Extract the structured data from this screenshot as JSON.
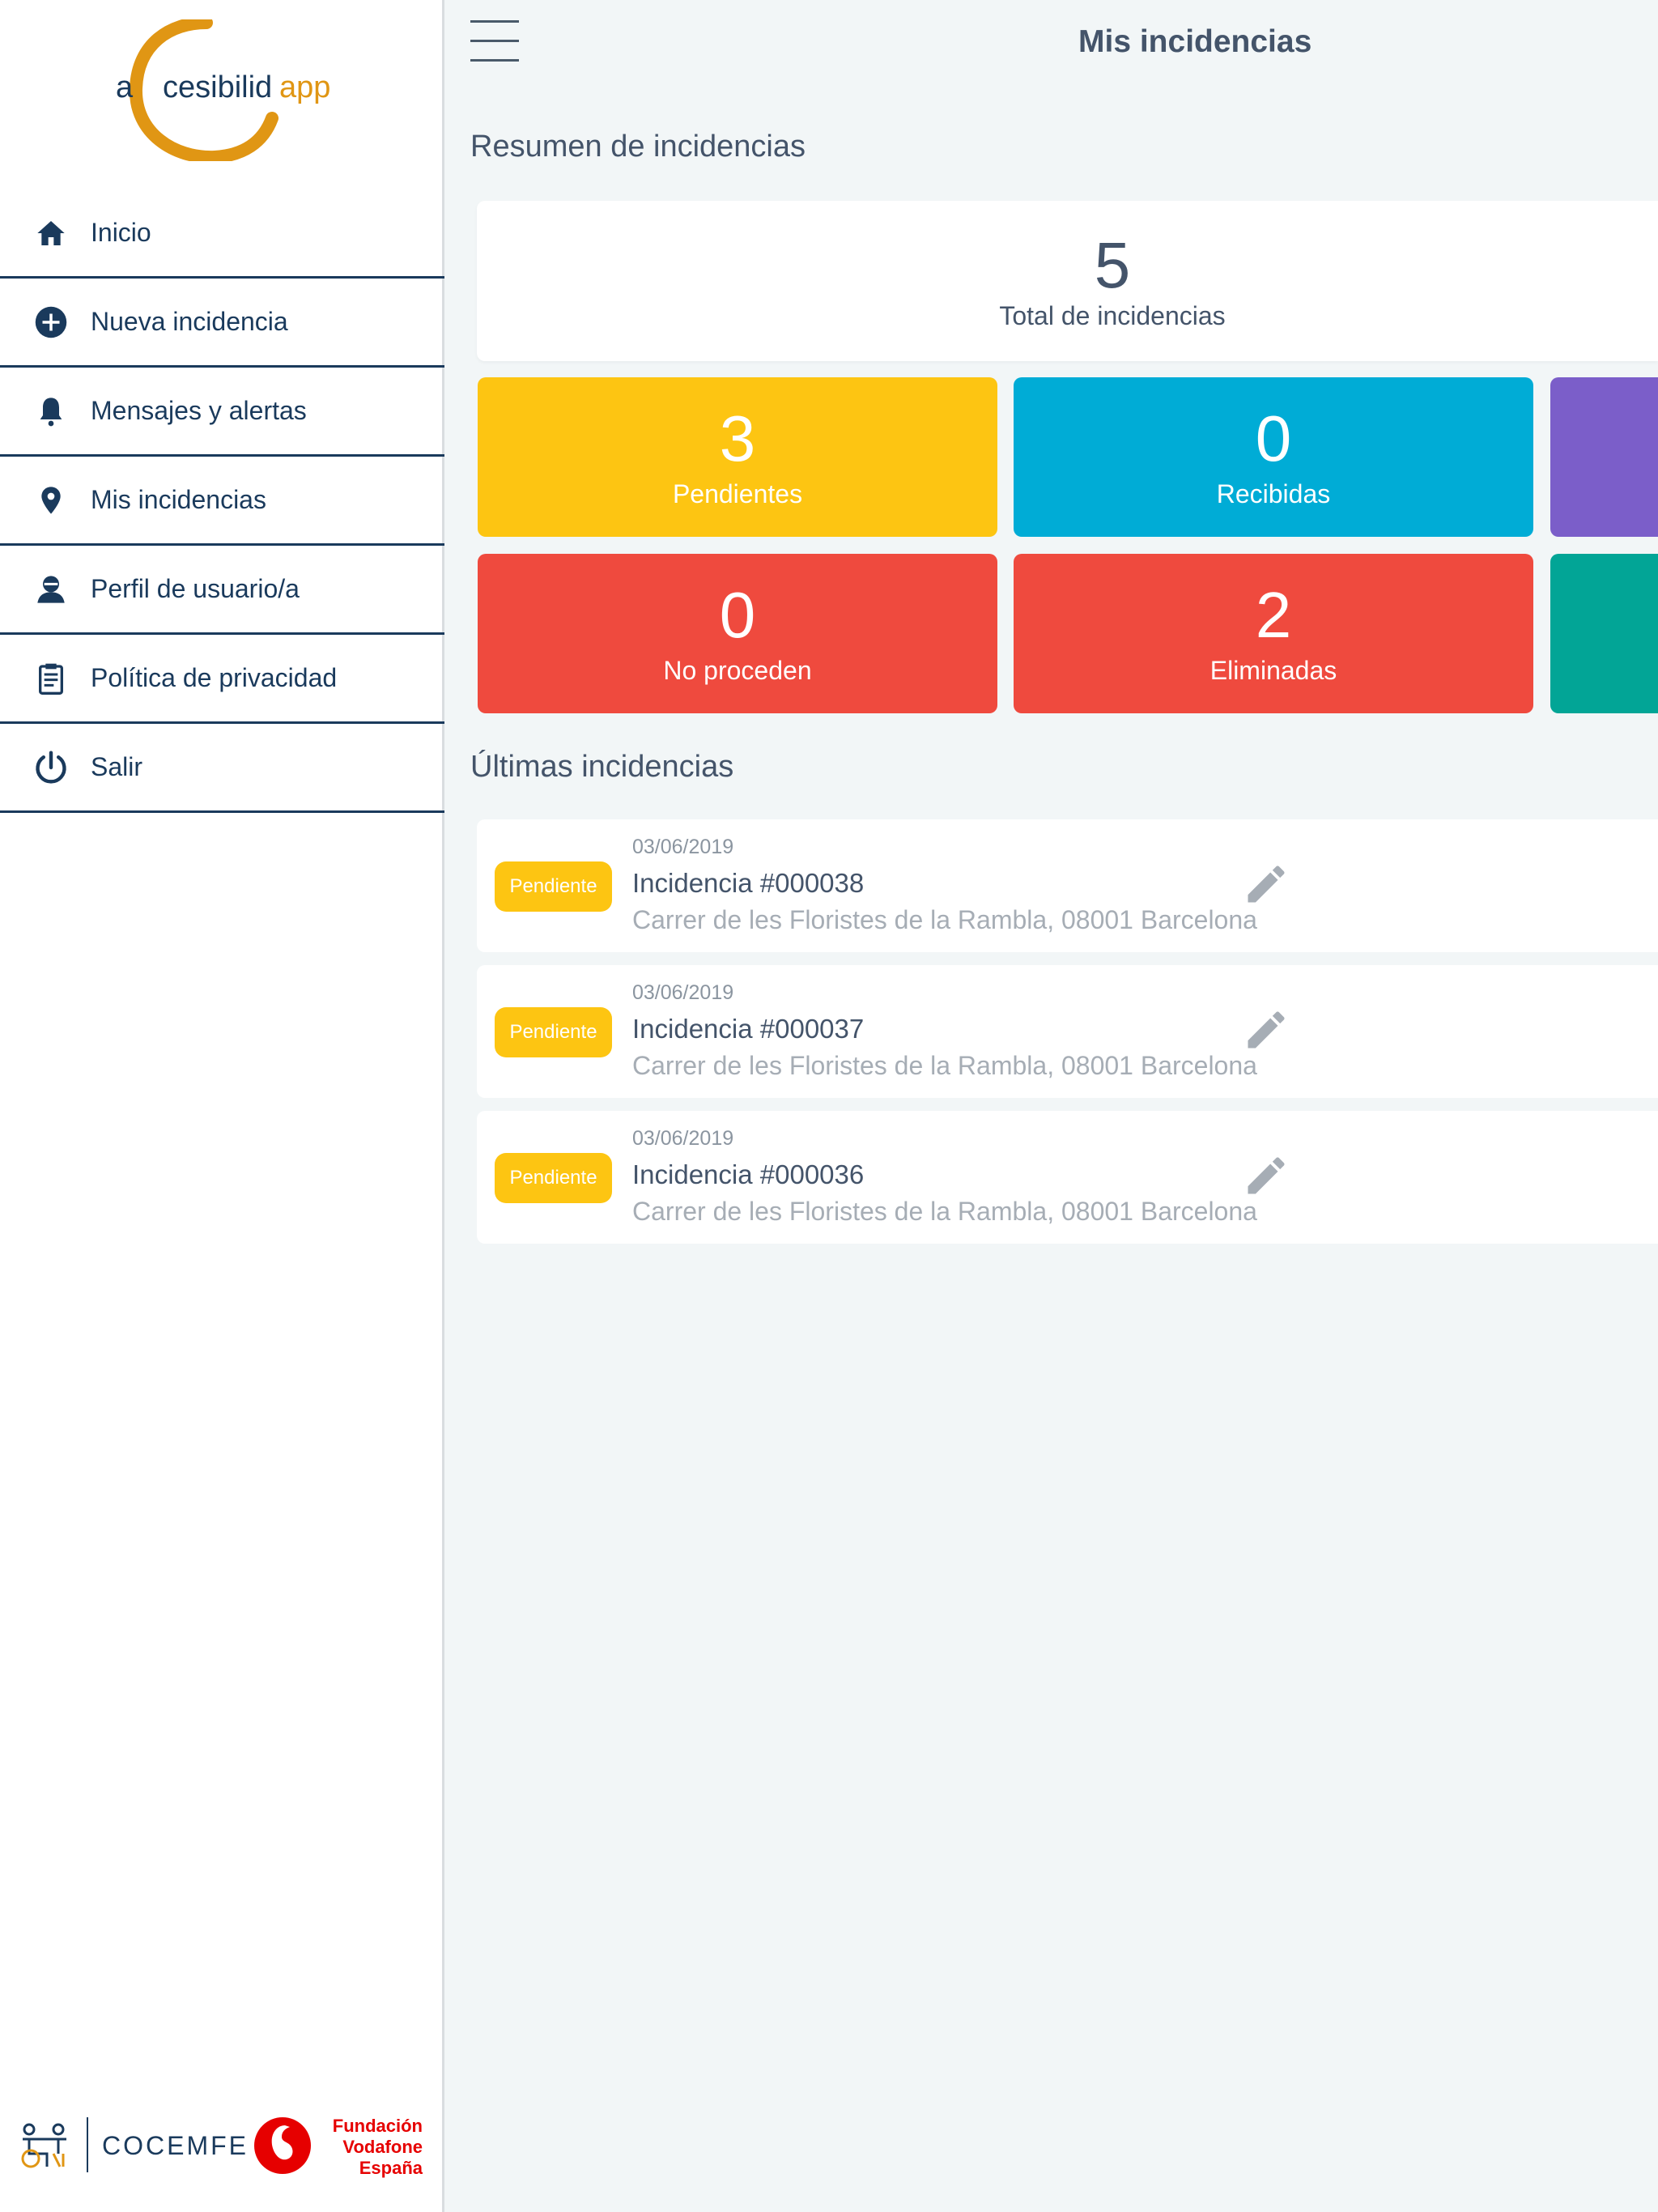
{
  "brand": {
    "logo_prefix": "a",
    "logo_middle": "cesibilid",
    "logo_suffix": "app",
    "primary_color": "#1a3a5c",
    "accent_color": "#e09614"
  },
  "sidebar": {
    "items": [
      {
        "label": "Inicio",
        "icon": "home-icon"
      },
      {
        "label": "Nueva incidencia",
        "icon": "plus-circle-icon"
      },
      {
        "label": "Mensajes y alertas",
        "icon": "bell-icon"
      },
      {
        "label": "Mis incidencias",
        "icon": "location-pin-icon"
      },
      {
        "label": "Perfil de usuario/a",
        "icon": "user-icon"
      },
      {
        "label": "Política de privacidad",
        "icon": "clipboard-icon"
      },
      {
        "label": "Salir",
        "icon": "power-icon"
      }
    ],
    "sponsors": {
      "cocemfe": "COCEMFE",
      "vodafone": [
        "Fundación",
        "Vodafone",
        "España"
      ]
    }
  },
  "header": {
    "title": "Mis incidencias"
  },
  "summary": {
    "title": "Resumen de incidencias",
    "total": {
      "value": "5",
      "label": "Total de incidencias"
    },
    "stats": [
      {
        "value": "3",
        "label": "Pendientes",
        "color": "#fdc512"
      },
      {
        "value": "0",
        "label": "Recibidas",
        "color": "#00acd6"
      },
      {
        "value": "",
        "label": "",
        "color": "#7b5ec9"
      },
      {
        "value": "0",
        "label": "No proceden",
        "color": "#ef4a3e"
      },
      {
        "value": "2",
        "label": "Eliminadas",
        "color": "#ef4a3e"
      },
      {
        "value": "",
        "label": "",
        "color": "#02a596"
      }
    ]
  },
  "latest": {
    "title": "Últimas incidencias",
    "items": [
      {
        "status": "Pendiente",
        "date": "03/06/2019",
        "title": "Incidencia #000038",
        "address": "Carrer de les Floristes de la Rambla, 08001 Barcelona"
      },
      {
        "status": "Pendiente",
        "date": "03/06/2019",
        "title": "Incidencia #000037",
        "address": "Carrer de les Floristes de la Rambla, 08001 Barcelona"
      },
      {
        "status": "Pendiente",
        "date": "03/06/2019",
        "title": "Incidencia #000036",
        "address": "Carrer de les Floristes de la Rambla, 08001 Barcelona"
      }
    ]
  }
}
